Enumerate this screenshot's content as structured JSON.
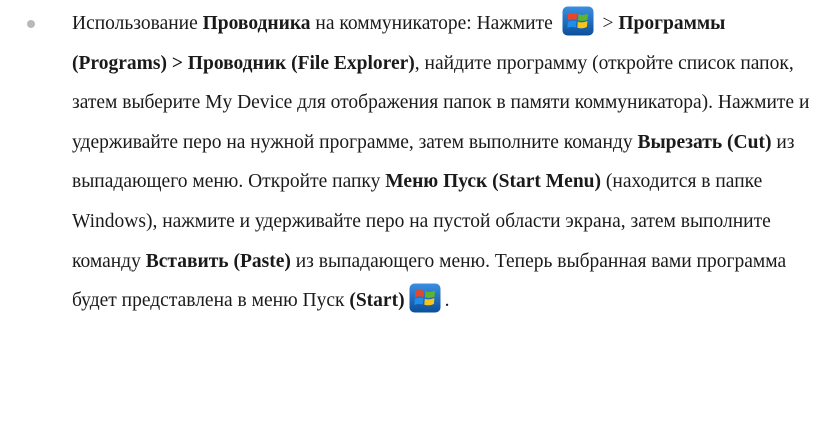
{
  "bullet_item": {
    "s1": "Использование ",
    "s2": "Проводника",
    "s3": " на коммуникаторе: Нажмите ",
    "s4": " > ",
    "s5": "Программы (Programs) > Проводник (File Explorer)",
    "s6": ", найдите программу (откройте список папок, затем выберите My Device для отображения папок в памяти коммуникатора). Нажмите и удерживайте перо на нужной программе, затем выполните команду ",
    "s7": "Вырезать (Cut)",
    "s8": " из выпадающего меню. Откройте папку ",
    "s9": "Меню Пуск (Start Menu)",
    "s10": " (находится в папке Windows), нажмите и удерживайте перо на пустой области экрана, затем выполните команду ",
    "s11": "Вставить (Paste)",
    "s12": " из выпадающего меню. Теперь выбранная вами программа будет представлена в меню Пуск ",
    "s13": "(Start)",
    "s14": ".",
    "icons": {
      "start_icon_1": "windows-start-logo",
      "start_icon_2": "windows-start-logo"
    }
  },
  "colors": {
    "bullet": "#b9b9b9",
    "text": "#1a1a1a",
    "logo_red": "#e8452a",
    "logo_green": "#5fb42c",
    "logo_blue": "#1f8ee8",
    "logo_yellow": "#f7c418",
    "logo_tile": "#1d6fbf"
  }
}
